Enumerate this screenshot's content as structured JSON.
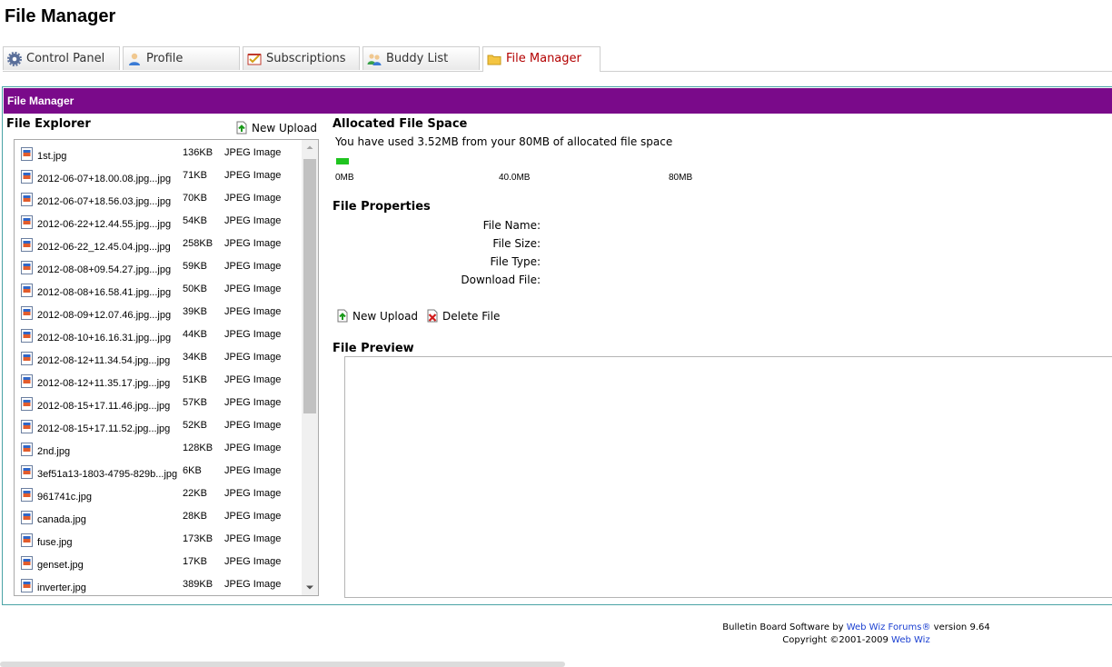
{
  "page": {
    "title": "File Manager"
  },
  "tabs": [
    {
      "label": "Control Panel",
      "icon": "gear-icon"
    },
    {
      "label": "Profile",
      "icon": "person-icon"
    },
    {
      "label": "Subscriptions",
      "icon": "checklist-icon"
    },
    {
      "label": "Buddy List",
      "icon": "buddies-icon"
    },
    {
      "label": "File Manager",
      "icon": "folder-icon",
      "active": true
    }
  ],
  "panel": {
    "header": "File Manager",
    "explorer_title": "File Explorer",
    "new_upload": "New Upload"
  },
  "files": [
    {
      "name": "1st.jpg",
      "size": "136KB",
      "type": "JPEG Image"
    },
    {
      "name": "2012-06-07+18.00.08.jpg...jpg",
      "size": "71KB",
      "type": "JPEG Image"
    },
    {
      "name": "2012-06-07+18.56.03.jpg...jpg",
      "size": "70KB",
      "type": "JPEG Image"
    },
    {
      "name": "2012-06-22+12.44.55.jpg...jpg",
      "size": "54KB",
      "type": "JPEG Image"
    },
    {
      "name": "2012-06-22_12.45.04.jpg...jpg",
      "size": "258KB",
      "type": "JPEG Image"
    },
    {
      "name": "2012-08-08+09.54.27.jpg...jpg",
      "size": "59KB",
      "type": "JPEG Image"
    },
    {
      "name": "2012-08-08+16.58.41.jpg...jpg",
      "size": "50KB",
      "type": "JPEG Image"
    },
    {
      "name": "2012-08-09+12.07.46.jpg...jpg",
      "size": "39KB",
      "type": "JPEG Image"
    },
    {
      "name": "2012-08-10+16.16.31.jpg...jpg",
      "size": "44KB",
      "type": "JPEG Image"
    },
    {
      "name": "2012-08-12+11.34.54.jpg...jpg",
      "size": "34KB",
      "type": "JPEG Image"
    },
    {
      "name": "2012-08-12+11.35.17.jpg...jpg",
      "size": "51KB",
      "type": "JPEG Image"
    },
    {
      "name": "2012-08-15+17.11.46.jpg...jpg",
      "size": "57KB",
      "type": "JPEG Image"
    },
    {
      "name": "2012-08-15+17.11.52.jpg...jpg",
      "size": "52KB",
      "type": "JPEG Image"
    },
    {
      "name": "2nd.jpg",
      "size": "128KB",
      "type": "JPEG Image"
    },
    {
      "name": "3ef51a13-1803-4795-829b...jpg",
      "size": "6KB",
      "type": "JPEG Image"
    },
    {
      "name": "961741c.jpg",
      "size": "22KB",
      "type": "JPEG Image"
    },
    {
      "name": "canada.jpg",
      "size": "28KB",
      "type": "JPEG Image"
    },
    {
      "name": "fuse.jpg",
      "size": "173KB",
      "type": "JPEG Image"
    },
    {
      "name": "genset.jpg",
      "size": "17KB",
      "type": "JPEG Image"
    },
    {
      "name": "inverter.jpg",
      "size": "389KB",
      "type": "JPEG Image"
    }
  ],
  "space": {
    "title": "Allocated File Space",
    "usage_text": "You have used 3.52MB from your 80MB of allocated file space",
    "used_fraction": 0.044,
    "scale_labels": [
      "0MB",
      "40.0MB",
      "80MB"
    ],
    "bar_color": "#1fc41f"
  },
  "properties": {
    "title": "File Properties",
    "labels": [
      "File Name:",
      "File Size:",
      "File Type:",
      "Download File:"
    ]
  },
  "actions": {
    "new_upload": "New Upload",
    "delete_file": "Delete File"
  },
  "preview": {
    "title": "File Preview"
  },
  "footer": {
    "line1_prefix": "Bulletin Board Software by ",
    "line1_link": "Web Wiz Forums®",
    "line1_suffix": " version 9.64",
    "line2_prefix": "Copyright ©2001-2009 ",
    "line2_link": "Web Wiz"
  },
  "colors": {
    "header_bg": "#7a0a8a",
    "active_tab_text": "#b30000",
    "link": "#1a3fd1",
    "border_accent": "#4aa3a6"
  }
}
